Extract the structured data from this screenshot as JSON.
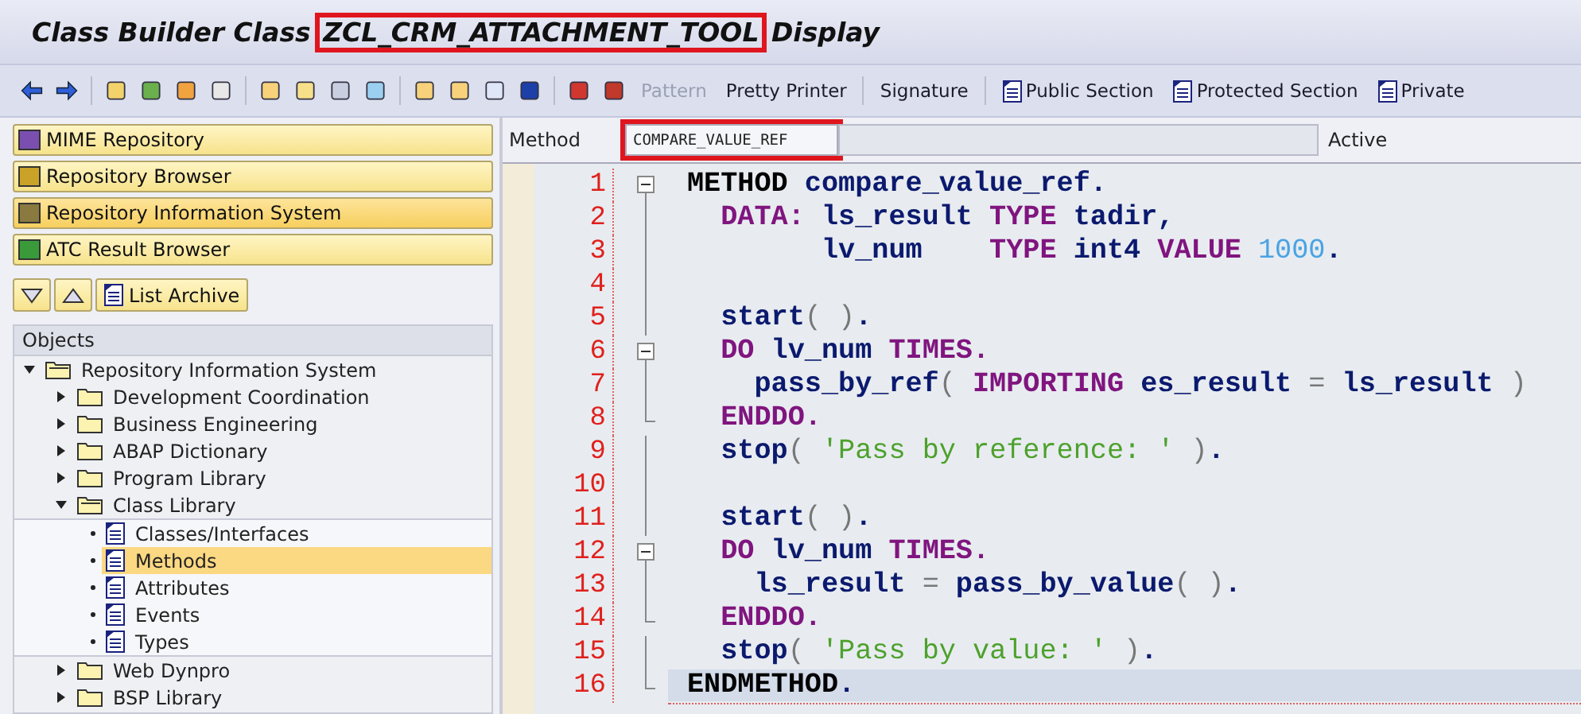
{
  "title": {
    "prefix": "Class Builder Class ",
    "object": "ZCL_CRM_ATTACHMENT_TOOL",
    "object_highlighted": true,
    "suffix": " Display"
  },
  "toolbar": {
    "buttons": [
      {
        "label": "Pattern",
        "disabled": true,
        "icon": false
      },
      {
        "label": "Pretty Printer",
        "disabled": false,
        "icon": false
      },
      {
        "label": "Signature",
        "disabled": false,
        "icon": false
      },
      {
        "label": "Public Section",
        "disabled": false,
        "icon": true
      },
      {
        "label": "Protected Section",
        "disabled": false,
        "icon": true
      },
      {
        "label": "Private",
        "disabled": false,
        "icon": true
      }
    ]
  },
  "nav_buttons": [
    {
      "label": "MIME Repository",
      "selected": false
    },
    {
      "label": "Repository Browser",
      "selected": false
    },
    {
      "label": "Repository Information System",
      "selected": true
    },
    {
      "label": "ATC Result Browser",
      "selected": false
    }
  ],
  "list_archive": {
    "label": "List Archive"
  },
  "objects": {
    "header": "Objects",
    "tree": [
      {
        "label": "Repository Information System",
        "kind": "folder",
        "expanded": true,
        "selected": false,
        "children": [
          {
            "label": "Development Coordination",
            "kind": "folder",
            "expanded": false,
            "selected": false
          },
          {
            "label": "Business Engineering",
            "kind": "folder",
            "expanded": false,
            "selected": false
          },
          {
            "label": "ABAP Dictionary",
            "kind": "folder",
            "expanded": false,
            "selected": false
          },
          {
            "label": "Program Library",
            "kind": "folder",
            "expanded": false,
            "selected": false
          },
          {
            "label": "Class Library",
            "kind": "folder",
            "expanded": true,
            "selected": false,
            "children": [
              {
                "label": "Classes/Interfaces",
                "kind": "leaf",
                "selected": false
              },
              {
                "label": "Methods",
                "kind": "leaf",
                "selected": true
              },
              {
                "label": "Attributes",
                "kind": "leaf",
                "selected": false
              },
              {
                "label": "Events",
                "kind": "leaf",
                "selected": false
              },
              {
                "label": "Types",
                "kind": "leaf",
                "selected": false
              }
            ]
          },
          {
            "label": "Web Dynpro",
            "kind": "folder",
            "expanded": false,
            "selected": false
          },
          {
            "label": "BSP Library",
            "kind": "folder",
            "expanded": false,
            "selected": false
          }
        ]
      }
    ]
  },
  "method_bar": {
    "label": "Method",
    "value": "COMPARE_VALUE_REF",
    "value_highlighted": true,
    "status": "Active"
  },
  "code": [
    {
      "number": "1",
      "kind": "block_start",
      "current": false,
      "tokens": [
        {
          "kind": "statement",
          "text": "METHOD"
        },
        {
          "kind": "name",
          "text": " compare_value_ref."
        }
      ]
    },
    {
      "number": "2",
      "kind": "block_line",
      "current": false,
      "tokens": [
        {
          "kind": "keyword",
          "text": "  DATA:"
        },
        {
          "kind": "name",
          "text": " ls_result "
        },
        {
          "kind": "keyword",
          "text": "TYPE"
        },
        {
          "kind": "name",
          "text": " tadir,"
        }
      ]
    },
    {
      "number": "3",
      "kind": "block_line",
      "current": false,
      "tokens": [
        {
          "kind": "name",
          "text": "        lv_num    "
        },
        {
          "kind": "keyword",
          "text": "TYPE"
        },
        {
          "kind": "name",
          "text": " int4 "
        },
        {
          "kind": "keyword",
          "text": "VALUE"
        },
        {
          "kind": "number",
          "text": " 1000"
        },
        {
          "kind": "name",
          "text": "."
        }
      ]
    },
    {
      "number": "4",
      "kind": "block_line",
      "current": false
    },
    {
      "number": "5",
      "kind": "block_line",
      "current": false,
      "tokens": [
        {
          "kind": "name",
          "text": "  start"
        },
        {
          "kind": "paren",
          "text": "( )"
        },
        {
          "kind": "name",
          "text": "."
        }
      ]
    },
    {
      "number": "6",
      "kind": "block_start",
      "current": false,
      "tokens": [
        {
          "kind": "keyword",
          "text": "  DO"
        },
        {
          "kind": "name",
          "text": " lv_num "
        },
        {
          "kind": "keyword",
          "text": "TIMES."
        }
      ]
    },
    {
      "number": "7",
      "kind": "block_line",
      "current": false,
      "tokens": [
        {
          "kind": "name",
          "text": "    pass_by_ref"
        },
        {
          "kind": "paren",
          "text": "( "
        },
        {
          "kind": "keyword",
          "text": "IMPORTING"
        },
        {
          "kind": "name",
          "text": " es_result "
        },
        {
          "kind": "paren",
          "text": "="
        },
        {
          "kind": "name",
          "text": " ls_result "
        },
        {
          "kind": "paren",
          "text": ")"
        }
      ]
    },
    {
      "number": "8",
      "kind": "block_end",
      "current": false,
      "tokens": [
        {
          "kind": "keyword",
          "text": "  ENDDO."
        }
      ]
    },
    {
      "number": "9",
      "kind": "block_line",
      "current": false,
      "tokens": [
        {
          "kind": "name",
          "text": "  stop"
        },
        {
          "kind": "paren",
          "text": "( "
        },
        {
          "kind": "string",
          "text": "'Pass by reference: '"
        },
        {
          "kind": "paren",
          "text": " )"
        },
        {
          "kind": "name",
          "text": "."
        }
      ]
    },
    {
      "number": "10",
      "kind": "block_line",
      "current": false
    },
    {
      "number": "11",
      "kind": "block_line",
      "current": false,
      "tokens": [
        {
          "kind": "name",
          "text": "  start"
        },
        {
          "kind": "paren",
          "text": "( )"
        },
        {
          "kind": "name",
          "text": "."
        }
      ]
    },
    {
      "number": "12",
      "kind": "block_start",
      "current": false,
      "tokens": [
        {
          "kind": "keyword",
          "text": "  DO"
        },
        {
          "kind": "name",
          "text": " lv_num "
        },
        {
          "kind": "keyword",
          "text": "TIMES."
        }
      ]
    },
    {
      "number": "13",
      "kind": "block_line",
      "current": false,
      "tokens": [
        {
          "kind": "name",
          "text": "    ls_result "
        },
        {
          "kind": "paren",
          "text": "="
        },
        {
          "kind": "name",
          "text": " pass_by_value"
        },
        {
          "kind": "paren",
          "text": "( )"
        },
        {
          "kind": "name",
          "text": "."
        }
      ]
    },
    {
      "number": "14",
      "kind": "block_end",
      "current": false,
      "tokens": [
        {
          "kind": "keyword",
          "text": "  ENDDO."
        }
      ]
    },
    {
      "number": "15",
      "kind": "block_line",
      "current": false,
      "tokens": [
        {
          "kind": "name",
          "text": "  stop"
        },
        {
          "kind": "paren",
          "text": "( "
        },
        {
          "kind": "string",
          "text": "'Pass by value: '"
        },
        {
          "kind": "paren",
          "text": " )"
        },
        {
          "kind": "name",
          "text": "."
        }
      ]
    },
    {
      "number": "16",
      "kind": "block_end",
      "current": true,
      "tokens": [
        {
          "kind": "statement",
          "text": "ENDMETHOD"
        },
        {
          "kind": "name",
          "text": "."
        }
      ]
    }
  ]
}
